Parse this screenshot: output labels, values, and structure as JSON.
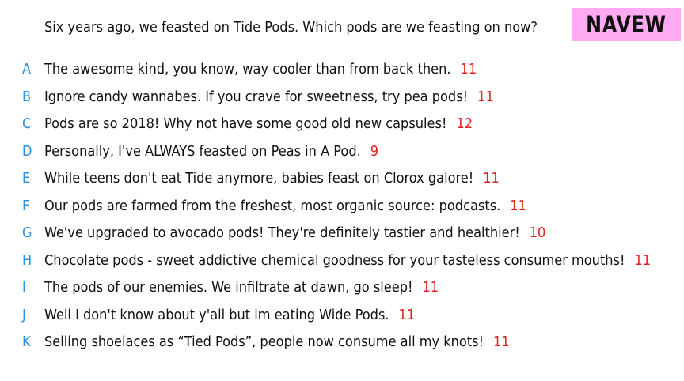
{
  "question": "Six years ago, we feasted on Tide Pods. Which pods are we feasting on now?",
  "tag": {
    "label": "NAVEW",
    "background": "#ffaaf2"
  },
  "colors": {
    "letter": "#2c8fe0",
    "score": "#e02020",
    "text": "#111111"
  },
  "options": [
    {
      "letter": "A",
      "text": "The awesome kind, you know, way cooler than from back then.",
      "score": "11"
    },
    {
      "letter": "B",
      "text": "Ignore candy wannabes. If you crave for sweetness, try pea pods!",
      "score": "11"
    },
    {
      "letter": "C",
      "text": "Pods are so 2018! Why not have some good old new capsules!",
      "score": "12"
    },
    {
      "letter": "D",
      "text": "Personally, I've ALWAYS feasted on Peas in A Pod.",
      "score": "9"
    },
    {
      "letter": "E",
      "text": "While teens don't eat Tide anymore, babies feast on Clorox galore!",
      "score": "11"
    },
    {
      "letter": "F",
      "text": "Our pods are farmed from the freshest, most organic source: podcasts.",
      "score": "11"
    },
    {
      "letter": "G",
      "text": "We've upgraded to avocado pods! They're definitely tastier and healthier!",
      "score": "10"
    },
    {
      "letter": "H",
      "text": "Chocolate pods - sweet addictive chemical goodness for your tasteless consumer mouths!",
      "score": "11"
    },
    {
      "letter": "I",
      "text": "The pods of our enemies. We infiltrate at dawn, go sleep!",
      "score": "11"
    },
    {
      "letter": "J",
      "text": "Well I don't know about y'all but im eating Wide Pods.",
      "score": "11"
    },
    {
      "letter": "K",
      "text": "Selling shoelaces as “Tied Pods”, people now consume all my knots!",
      "score": "11"
    }
  ]
}
